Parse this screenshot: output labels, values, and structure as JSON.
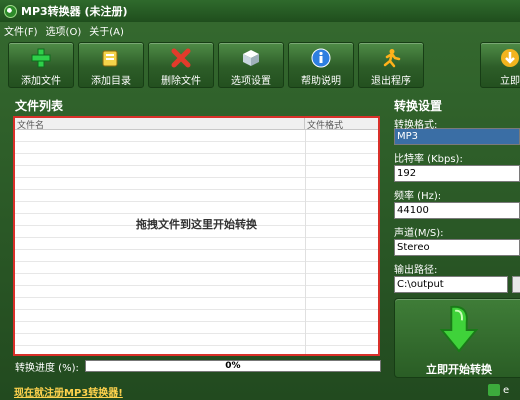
{
  "window": {
    "title": "MP3转换器 (未注册)"
  },
  "menu": [
    "文件(F)",
    "选项(O)",
    "关于(A)"
  ],
  "toolbar": {
    "buttons": [
      {
        "label": "添加文件",
        "icon": "plus-icon"
      },
      {
        "label": "添加目录",
        "icon": "folder-icon"
      },
      {
        "label": "删除文件",
        "icon": "delete-x-icon"
      },
      {
        "label": "选项设置",
        "icon": "cube-settings-icon"
      },
      {
        "label": "帮助说明",
        "icon": "info-icon"
      },
      {
        "label": "退出程序",
        "icon": "exit-runner-icon"
      },
      {
        "label": "立即",
        "icon": "start-arrow-icon"
      }
    ]
  },
  "file_list": {
    "title": "文件列表",
    "columns": [
      "文件名",
      "文件格式"
    ],
    "drop_hint": "拖拽文件到这里开始转换"
  },
  "progress": {
    "label": "转换进度 (%):",
    "value": 0,
    "text": "0%"
  },
  "settings": {
    "title": "转换设置",
    "format_label": "转换格式:",
    "format_value": "MP3",
    "bitrate_label": "比特率 (Kbps):",
    "bitrate_value": "192",
    "freq_label": "频率 (Hz):",
    "freq_value": "44100",
    "channel_label": "声道(M/S):",
    "channel_value": "Stereo",
    "output_label": "输出路径:",
    "output_value": "C:\\output"
  },
  "start_button": {
    "label": "立即开始转换"
  },
  "status": {
    "register_link": "现在就注册MP3转换器!",
    "right_text": "e"
  },
  "colors": {
    "accent_green": "#2d5d28",
    "highlight_red": "#d9302a",
    "select_blue": "#3a6ea5"
  }
}
